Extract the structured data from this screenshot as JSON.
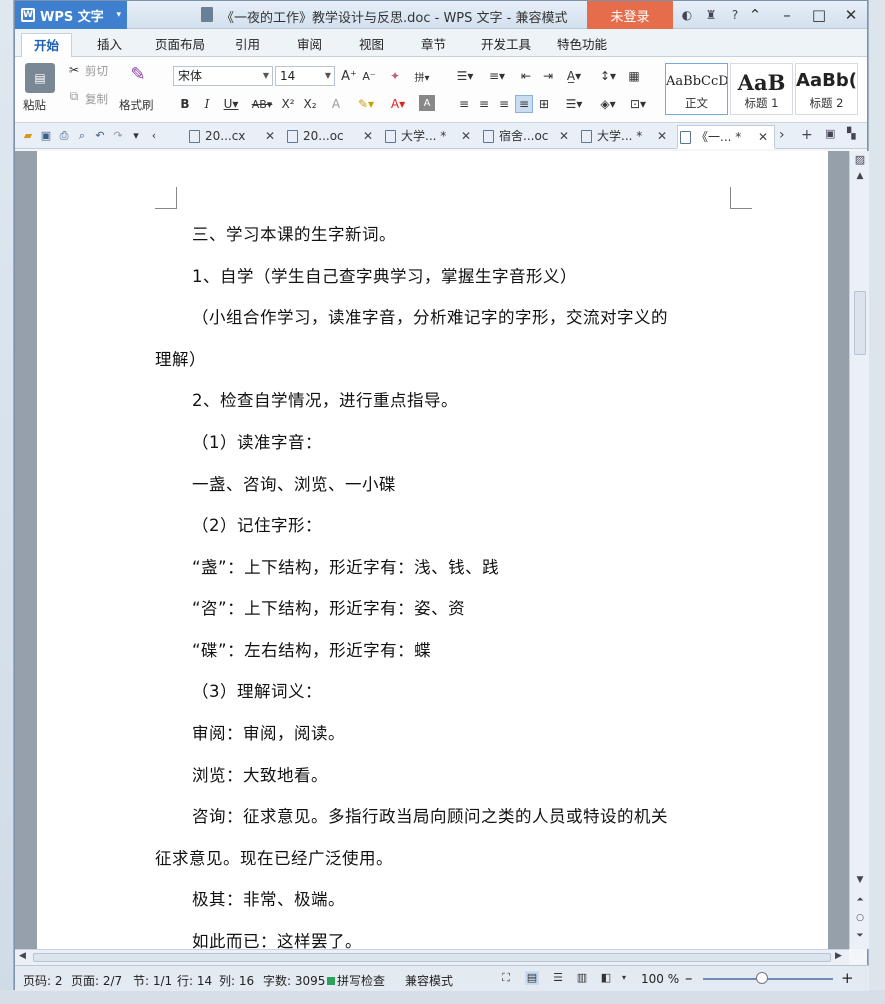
{
  "titlebar": {
    "app_name": "WPS 文字",
    "doc_title": "《一夜的工作》教学设计与反思.doc - WPS 文字 - 兼容模式",
    "login": "未登录",
    "help": "?"
  },
  "menu": {
    "tabs": [
      "开始",
      "插入",
      "页面布局",
      "引用",
      "审阅",
      "视图",
      "章节",
      "开发工具",
      "特色功能"
    ]
  },
  "ribbon": {
    "cut": "剪切",
    "copy": "复制",
    "paste": "粘贴",
    "format_painter": "格式刷",
    "font_name": "宋体",
    "font_size": "14",
    "styles": [
      {
        "preview": "AaBbCcD",
        "name": "正文"
      },
      {
        "preview": "AaB",
        "name": "标题 1"
      },
      {
        "preview": "AaBb(",
        "name": "标题 2"
      }
    ]
  },
  "doc_tabs": [
    {
      "label": "20...cx"
    },
    {
      "label": "20...oc"
    },
    {
      "label": "大学... *"
    },
    {
      "label": "宿舍...oc"
    },
    {
      "label": "大学... *"
    },
    {
      "label": "《一... *"
    }
  ],
  "document": {
    "paragraphs": [
      "三、学习本课的生字新词。",
      "1、自学（学生自己查字典学习，掌握生字音形义）",
      "（小组合作学习，读准字音，分析难记字的字形，交流对字义的",
      "理解）",
      "2、检查自学情况，进行重点指导。",
      "（1）读准字音：",
      "一盏、咨询、浏览、一小碟",
      "（2）记住字形：",
      "“盏”：上下结构，形近字有：浅、钱、践",
      "“咨”：上下结构，形近字有：姿、资",
      "“碟”：左右结构，形近字有：蝶",
      "（3）理解词义：",
      "审阅：审阅，阅读。",
      "浏览：大致地看。",
      "咨询：征求意见。多指行政当局向顾问之类的人员或特设的机关",
      "征求意见。现在已经广泛使用。",
      "极其：非常、极端。",
      "如此而已：这样罢了。"
    ]
  },
  "statusbar": {
    "page_code": "页码: 2",
    "pages": "页面: 2/7",
    "section": "节: 1/1",
    "row": "行: 14",
    "col": "列: 16",
    "words": "字数: 3095",
    "spell": "拼写检查",
    "compat": "兼容模式",
    "zoom": "100 %",
    "zoom_level": 0.45
  }
}
